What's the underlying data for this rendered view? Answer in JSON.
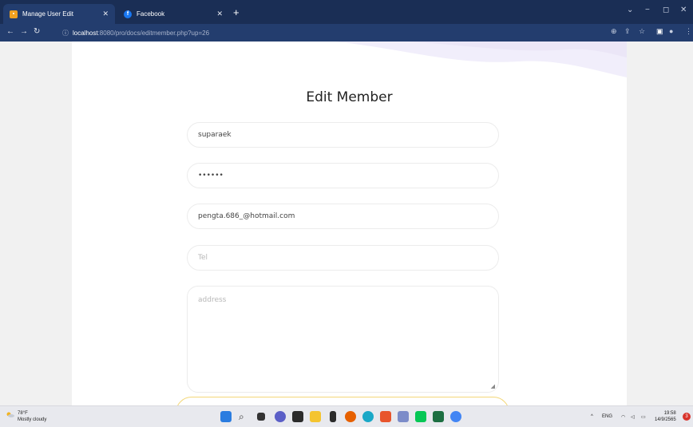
{
  "browser": {
    "tabs": [
      {
        "title": "Manage User Edit",
        "icon": "orange-app-icon",
        "active": true
      },
      {
        "title": "Facebook",
        "icon": "facebook-icon",
        "active": false
      }
    ],
    "url_host": "localhost",
    "url_path": ":8080/pro/docs/editmember.php?up=26"
  },
  "form": {
    "title": "Edit Member",
    "username_value": "suparaek",
    "password_value": "••••••",
    "email_value": "pengta.686_@hotmail.com",
    "tel_placeholder": "Tel",
    "address_placeholder": "address"
  },
  "taskbar": {
    "weather_temp": "78°F",
    "weather_desc": "Mostly cloudy",
    "tray_lang": "ENG",
    "time": "19:58",
    "date": "14/9/2565",
    "notification_count": "3"
  },
  "colors": {
    "tabbar": "#1a2e55",
    "addressbar": "#233d6e",
    "submit_border": "#f3d778"
  }
}
